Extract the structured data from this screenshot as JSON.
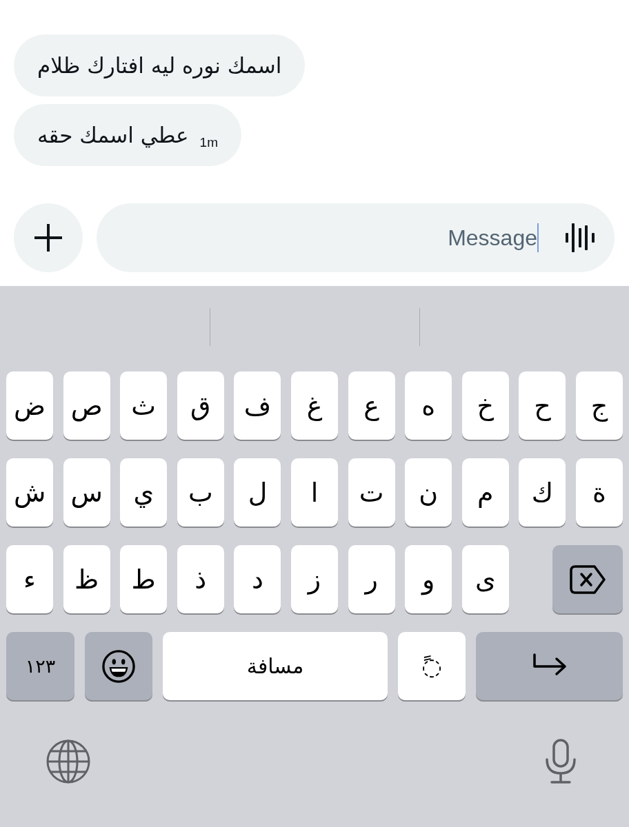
{
  "messages": [
    {
      "text": "اسمك نوره ليه افتارك ظلام"
    },
    {
      "text": "عطي اسمك حقه",
      "time": "1m"
    }
  ],
  "composer": {
    "placeholder": "Message",
    "focused": true
  },
  "keyboard": {
    "rows": [
      {
        "keys": [
          {
            "kind": "letter",
            "label": "ج"
          },
          {
            "kind": "letter",
            "label": "ح"
          },
          {
            "kind": "letter",
            "label": "خ"
          },
          {
            "kind": "letter",
            "label": "ه"
          },
          {
            "kind": "letter",
            "label": "ع"
          },
          {
            "kind": "letter",
            "label": "غ"
          },
          {
            "kind": "letter",
            "label": "ف"
          },
          {
            "kind": "letter",
            "label": "ق"
          },
          {
            "kind": "letter",
            "label": "ث"
          },
          {
            "kind": "letter",
            "label": "ص"
          },
          {
            "kind": "letter",
            "label": "ض"
          }
        ]
      },
      {
        "keys": [
          {
            "kind": "letter",
            "label": "ة"
          },
          {
            "kind": "letter",
            "label": "ك"
          },
          {
            "kind": "letter",
            "label": "م"
          },
          {
            "kind": "letter",
            "label": "ن"
          },
          {
            "kind": "letter",
            "label": "ت"
          },
          {
            "kind": "letter",
            "label": "ا"
          },
          {
            "kind": "letter",
            "label": "ل"
          },
          {
            "kind": "letter",
            "label": "ب"
          },
          {
            "kind": "letter",
            "label": "ي"
          },
          {
            "kind": "letter",
            "label": "س"
          },
          {
            "kind": "letter",
            "label": "ش"
          }
        ]
      },
      {
        "keys": [
          {
            "kind": "backspace"
          },
          {
            "kind": "letter",
            "label": "ى"
          },
          {
            "kind": "letter",
            "label": "و"
          },
          {
            "kind": "letter",
            "label": "ر"
          },
          {
            "kind": "letter",
            "label": "ز"
          },
          {
            "kind": "letter",
            "label": "د"
          },
          {
            "kind": "letter",
            "label": "ذ"
          },
          {
            "kind": "letter",
            "label": "ط"
          },
          {
            "kind": "letter",
            "label": "ظ"
          },
          {
            "kind": "letter",
            "label": "ء"
          }
        ]
      },
      {
        "keys": [
          {
            "kind": "return"
          },
          {
            "kind": "diacritic",
            "label": "◌ً"
          },
          {
            "kind": "space",
            "label": "مسافة"
          },
          {
            "kind": "emoji"
          },
          {
            "kind": "numbers",
            "label": "١٢٣"
          }
        ]
      }
    ],
    "bottom_bar": [
      {
        "kind": "globe"
      },
      {
        "kind": "microphone"
      }
    ]
  }
}
